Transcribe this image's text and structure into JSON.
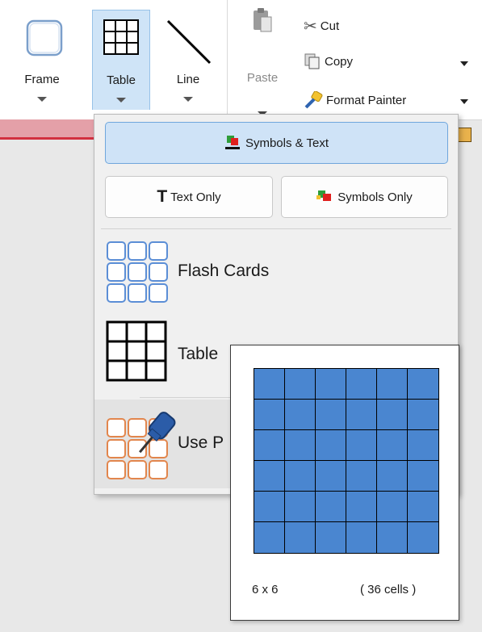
{
  "ribbon": {
    "frame_label": "Frame",
    "table_label": "Table",
    "line_label": "Line",
    "paste_label": "Paste",
    "cut_label": "Cut",
    "copy_label": "Copy",
    "format_painter_label": "Format Painter"
  },
  "table_menu": {
    "symbols_text_label": "Symbols & Text",
    "text_only_label": "Text Only",
    "symbols_only_label": "Symbols Only",
    "flash_cards_label": "Flash Cards",
    "table_label": "Table",
    "use_label": "Use P"
  },
  "table_picker": {
    "rows": 6,
    "cols": 6,
    "dimension_label": "6 x 6",
    "cell_count_label": "( 36 cells )",
    "cell_color": "#4a86d0"
  },
  "colors": {
    "selected_bg": "#cfe4f7",
    "selected_border": "#6fa6dc",
    "red_bar": "#d2303f"
  }
}
